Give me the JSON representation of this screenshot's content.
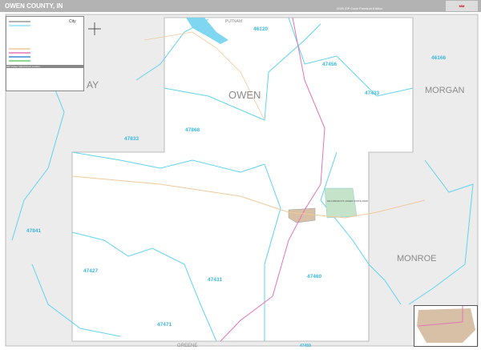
{
  "header": {
    "title": "OWEN COUNTY, IN",
    "edition": "2020 ZIP Code Premium Edition",
    "logo": "MARKET MAPS"
  },
  "legend": {
    "city_label": "City",
    "index_header": "ZIP Codes Index/Cross Locator"
  },
  "counties": {
    "north": "PUTNAM",
    "east_upper": "MORGAN",
    "east_lower": "MONROE",
    "west": "AY",
    "south": "GREENE",
    "center": "OWEN"
  },
  "zip_codes": [
    "46120",
    "47456",
    "46166",
    "47868",
    "47433",
    "47833",
    "47841",
    "47427",
    "47431",
    "47460",
    "47471",
    "47459"
  ],
  "park": "MCCORMICK'S CREEK STATE PARK",
  "colors": {
    "county_fill": "#ffffff",
    "outside_fill": "#ececec",
    "zip_boundary": "#5fd3ef",
    "highway": "#e573b8",
    "road": "#f0c99a",
    "water": "#7fd6f0",
    "park": "#c4e3c9",
    "city": "#d7c0a6",
    "title_bar": "#b3b3b3"
  }
}
